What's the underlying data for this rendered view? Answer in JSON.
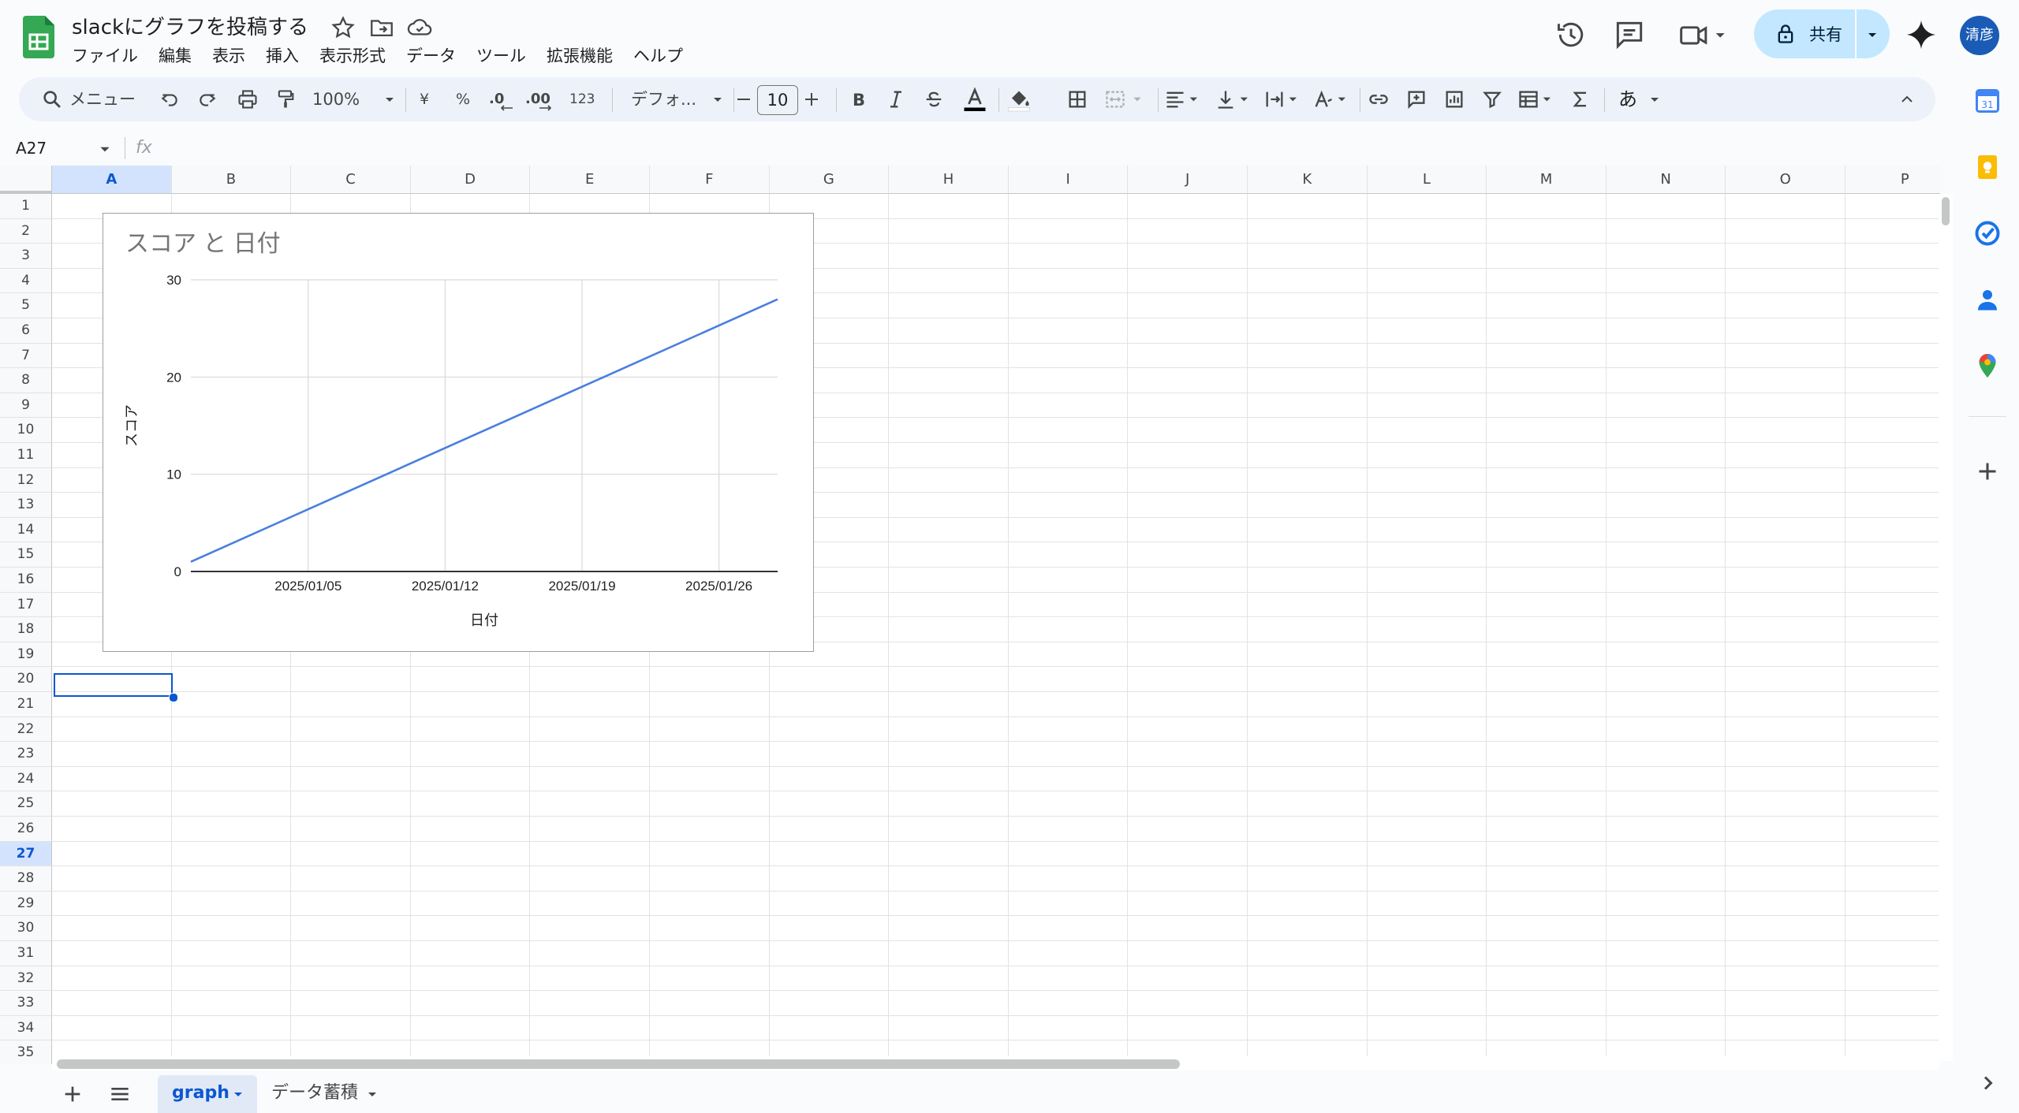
{
  "document": {
    "title": "slackにグラフを投稿する"
  },
  "menu": [
    "ファイル",
    "編集",
    "表示",
    "挿入",
    "表示形式",
    "データ",
    "ツール",
    "拡張機能",
    "ヘルプ"
  ],
  "header": {
    "share_label": "共有",
    "avatar_initials": "清彦"
  },
  "toolbar": {
    "search_label": "メニュー",
    "zoom": "100%",
    "currency_symbol": "¥",
    "percent_symbol": "%",
    "decrease_decimal": ".0",
    "increase_decimal": ".00",
    "number_format": "123",
    "font_family": "デフォ...",
    "font_size": "10",
    "input_tools_label": "あ"
  },
  "formula_bar": {
    "name_box": "A27",
    "fx_label": "fx",
    "content": ""
  },
  "grid": {
    "columns": [
      "A",
      "B",
      "C",
      "D",
      "E",
      "F",
      "G",
      "H",
      "I",
      "J",
      "K",
      "L",
      "M",
      "N",
      "O",
      "P"
    ],
    "rows": [
      "1",
      "2",
      "3",
      "4",
      "5",
      "6",
      "7",
      "8",
      "9",
      "10",
      "11",
      "12",
      "13",
      "14",
      "15",
      "16",
      "17",
      "18",
      "19",
      "20",
      "21",
      "22",
      "23",
      "24",
      "25",
      "26",
      "27",
      "28",
      "29",
      "30",
      "31",
      "32",
      "33",
      "34",
      "35"
    ],
    "selected_column": "A",
    "selected_row": "27"
  },
  "chart_data": {
    "type": "line",
    "title": "スコア と 日付",
    "xlabel": "日付",
    "ylabel": "スコア",
    "x_ticks": [
      "2025/01/05",
      "2025/01/12",
      "2025/01/19",
      "2025/01/26"
    ],
    "y_ticks": [
      0,
      10,
      20,
      30
    ],
    "ylim": [
      0,
      30
    ],
    "xlim": [
      "2024/12/30",
      "2025/01/29"
    ],
    "grid": true,
    "series": [
      {
        "color": "#4a7fde",
        "x": [
          "2024/12/30",
          "2025/01/29"
        ],
        "y": [
          1,
          28
        ]
      }
    ]
  },
  "sheets": {
    "tabs": [
      {
        "label": "graph",
        "active": true
      },
      {
        "label": "データ蓄積",
        "active": false
      }
    ]
  },
  "colors": {
    "accent": "#0b57d0",
    "share_bg": "#c2e7ff",
    "sheets_green": "#34a853"
  }
}
